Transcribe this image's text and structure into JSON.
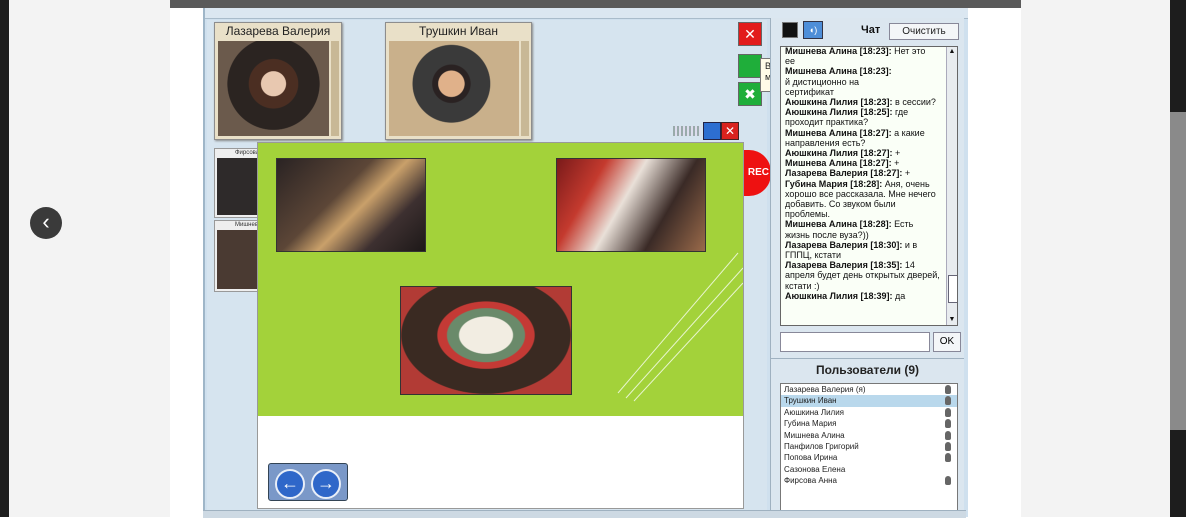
{
  "video": {
    "participant1": "Лазарева Валерия",
    "participant2": "Трушкин Иван",
    "mini1": "Фирсова",
    "mini2": "Мишнева"
  },
  "controls": {
    "tooltip": "Вкл./выкл. микрофон",
    "rec_label": "REC"
  },
  "chat": {
    "title": "Чат",
    "clear_label": "Очистить",
    "ok_label": "OK",
    "messages": [
      {
        "author": "Мишнева Алина",
        "time": "[18:23]:",
        "text": "Нет это"
      },
      {
        "author": "",
        "time": "",
        "text": "ее"
      },
      {
        "author": "Мишнева Алина",
        "time": "[18:23]:",
        "text": ""
      },
      {
        "author": "",
        "time": "",
        "text": "й дистиционно на"
      },
      {
        "author": "",
        "time": "",
        "text": "сертификат"
      },
      {
        "author": "Аюшкина Лилия",
        "time": "[18:23]:",
        "text": "в сессии?"
      },
      {
        "author": "Аюшкина Лилия",
        "time": "[18:25]:",
        "text": "где проходит практика?"
      },
      {
        "author": "Мишнева Алина",
        "time": "[18:27]:",
        "text": "а какие направления есть?"
      },
      {
        "author": "Аюшкина Лилия",
        "time": "[18:27]:",
        "text": "+"
      },
      {
        "author": "Мишнева Алина",
        "time": "[18:27]:",
        "text": "+"
      },
      {
        "author": "Лазарева Валерия",
        "time": "[18:27]:",
        "text": "+"
      },
      {
        "author": "Губина Мария",
        "time": "[18:28]:",
        "text": "Аня, очень хорошо все рассказала. Мне нечего добавить. Со звуком были проблемы."
      },
      {
        "author": "Мишнева Алина",
        "time": "[18:28]:",
        "text": "Есть жизнь после вуза?))"
      },
      {
        "author": "Лазарева Валерия",
        "time": "[18:30]:",
        "text": "и в ГППЦ, кстати"
      },
      {
        "author": "Лазарева Валерия",
        "time": "[18:35]:",
        "text": "14 апреля будет день открытых дверей, кстати :)"
      },
      {
        "author": "Аюшкина Лилия",
        "time": "[18:39]:",
        "text": "да"
      }
    ]
  },
  "users": {
    "title": "Пользователи (9)",
    "list": [
      {
        "name": "Лазарева Валерия (я)",
        "selected": false,
        "mic": true
      },
      {
        "name": "Трушкин Иван",
        "selected": true,
        "mic": true
      },
      {
        "name": "Аюшкина Лилия",
        "selected": false,
        "mic": true
      },
      {
        "name": "Губина Мария",
        "selected": false,
        "mic": true
      },
      {
        "name": "Мишнева Алина",
        "selected": false,
        "mic": true
      },
      {
        "name": "Панфилов Григорий",
        "selected": false,
        "mic": true
      },
      {
        "name": "Попова Ирина",
        "selected": false,
        "mic": true
      },
      {
        "name": "Сазонова Елена",
        "selected": false,
        "mic": false
      },
      {
        "name": "Фирсова Анна",
        "selected": false,
        "mic": true
      }
    ]
  }
}
